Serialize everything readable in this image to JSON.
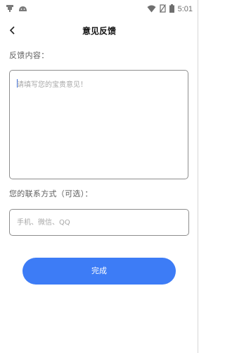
{
  "status_bar": {
    "time": "5:01",
    "left_icons": [
      "notification-app-icon",
      "android-icon"
    ],
    "right_icons": [
      "wifi-icon",
      "no-sim-icon",
      "battery-icon"
    ]
  },
  "header": {
    "title": "意见反馈",
    "back_icon": "back-arrow-icon"
  },
  "form": {
    "content_label": "反馈内容：",
    "content_placeholder": "请填写您的宝贵意见！",
    "content_value": "",
    "contact_label": "您的联系方式（可选）：",
    "contact_placeholder": "手机、微信、QQ",
    "contact_value": "",
    "submit_label": "完成"
  },
  "colors": {
    "accent": "#3d7cf6",
    "border": "#8e8e8e",
    "placeholder": "#a8a8a8",
    "label": "#5e5e5e"
  }
}
